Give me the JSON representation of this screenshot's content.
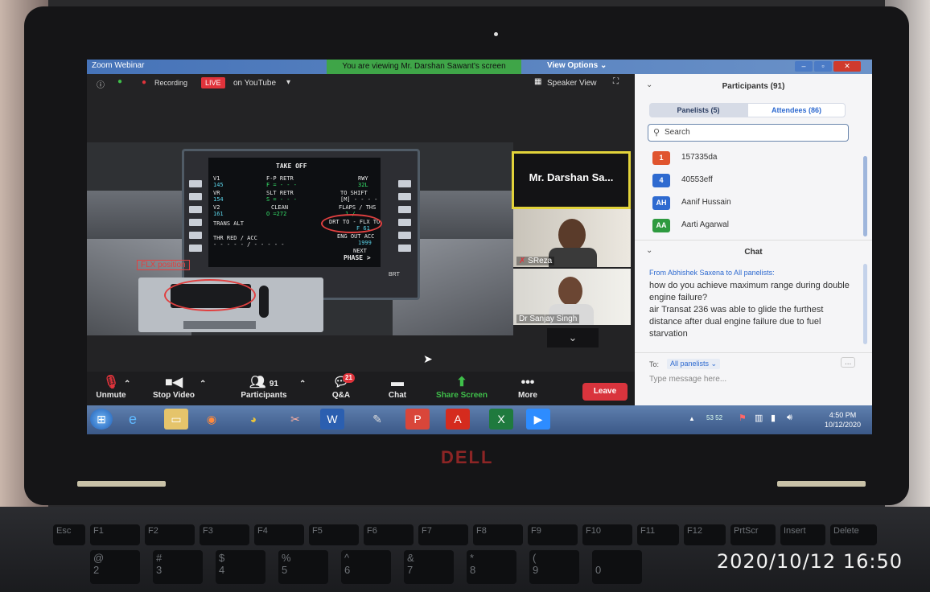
{
  "window": {
    "title": "Zoom Webinar",
    "viewing_banner": "You are viewing Mr. Darshan Sawant's screen",
    "view_options": "View Options ⌄"
  },
  "zoom_top": {
    "recording": "Recording",
    "live": "LIVE",
    "destination": "on YouTube",
    "speaker_view": "Speaker View"
  },
  "mcdu": {
    "title": "TAKE OFF",
    "v1_label": "V1",
    "v1": "145",
    "vr_label": "VR",
    "vr": "154",
    "v2_label": "V2",
    "v2": "161",
    "flp_retr": "F-P RETR",
    "flp_val": "F = - - -",
    "slt_retr": "SLT RETR",
    "slt_val": "S = - - -",
    "clean": "CLEAN",
    "clean_val": "O =272",
    "rwy_label": "RWY",
    "rwy": "32L",
    "to_shift": "TO SHIFT",
    "to_shift_val": "[M] - - - -",
    "flaps_ths": "FLAPS / THS",
    "flaps_val": "1 /",
    "flex_label": "DRT TO - FLX TO",
    "flex_val": "F 61",
    "eng_out": "ENG OUT ACC",
    "eng_out_val": "1999",
    "trans_alt": "TRANS ALT",
    "thr_red": "THR RED / ACC",
    "thr_val": "- - - - - / - - - - -",
    "next": "NEXT",
    "phase": "PHASE >",
    "brt": "BRT"
  },
  "annotation": {
    "flx_position": "FLX position"
  },
  "videos": {
    "presenter": "Mr. Darshan Sa...",
    "sreza": "SReza",
    "sanjay": "Dr Sanjay Singh"
  },
  "toolbar": {
    "unmute": "Unmute",
    "stop_video": "Stop Video",
    "participants": "Participants",
    "participants_count": "91",
    "qa": "Q&A",
    "qa_badge": "21",
    "chat": "Chat",
    "share_screen": "Share Screen",
    "more": "More",
    "leave": "Leave"
  },
  "participants": {
    "title": "Participants (91)",
    "tab_panelists": "Panelists (5)",
    "tab_attendees": "Attendees (86)",
    "search_placeholder": "Search",
    "items": [
      {
        "avatar": "1",
        "name": "157335da",
        "color": "#e0542e"
      },
      {
        "avatar": "4",
        "name": "40553eff",
        "color": "#2e6ad0"
      },
      {
        "avatar": "AH",
        "name": "Aanif Hussain",
        "color": "#2e6ad0"
      },
      {
        "avatar": "AA",
        "name": "Aarti Agarwal",
        "color": "#2e9a3f"
      }
    ]
  },
  "chat": {
    "title": "Chat",
    "from": "From Abhishek Saxena to All panelists:",
    "message1": "how do you achieve maximum range during double engine failure?",
    "message2": "air Transat 236 was able to glide the furthest distance after dual engine failure due to fuel starvation",
    "to_label": "To:",
    "to_value": "All panelists ⌄",
    "placeholder": "Type message here...",
    "more": "..."
  },
  "taskbar": {
    "tray": "53 52",
    "time": "4:50 PM",
    "date": "10/12/2020"
  },
  "laptop": {
    "brand": "DELL"
  },
  "keys": {
    "esc": "Esc",
    "f1": "F1",
    "f2": "F2",
    "f3": "F3",
    "f4": "F4",
    "f5": "F5",
    "f6": "F6",
    "f7": "F7",
    "f8": "F8",
    "f9": "F9",
    "f10": "F10",
    "f11": "F11",
    "f12": "F12",
    "prtscr": "PrtScr",
    "insert": "Insert",
    "delete": "Delete",
    "n2": "2",
    "n3": "3",
    "n4": "4",
    "n5": "5",
    "n6": "6",
    "n7": "7",
    "n8": "8",
    "n9": "9",
    "n0": "0",
    "at": "@",
    "hash": "#",
    "dollar": "$",
    "pct": "%",
    "caret": "^",
    "amp": "&",
    "star": "*",
    "paren": "("
  },
  "photo_timestamp": "2020/10/12  16:50"
}
